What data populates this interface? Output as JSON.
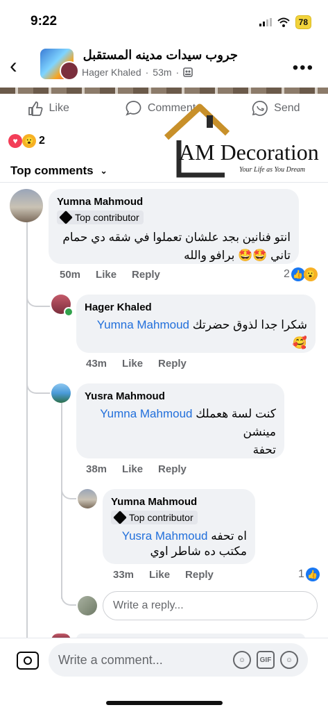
{
  "status": {
    "time": "9:22",
    "battery": "78"
  },
  "header": {
    "group_name": "جروب سيدات مدينه المستقبل",
    "poster": "Hager Khaled",
    "time": "53m"
  },
  "post_actions": {
    "like": "Like",
    "comment": "Comment",
    "send": "Send"
  },
  "watermark": {
    "brand": "AM Decoration",
    "tagline": "Your Life as You Dream"
  },
  "reactions": {
    "count": "2"
  },
  "sort": {
    "label": "Top comments"
  },
  "comments": [
    {
      "author": "Yumna Mahmoud",
      "badge": "Top contributor",
      "text_line1": "انتو فنانين بجد علشان تعملوا في شقه دي حمام",
      "text_line2": "تاني 🤩🤩 برافو والله",
      "time": "50m",
      "like": "Like",
      "reply": "Reply",
      "reaction_count": "2"
    },
    {
      "author": "Hager Khaled",
      "mention": "Yumna Mahmoud",
      "text": "شكرا جدا لذوق حضرتك",
      "emoji": "🥰",
      "time": "43m",
      "like": "Like",
      "reply": "Reply"
    },
    {
      "author": "Yusra Mahmoud",
      "mention": "Yumna Mahmoud",
      "text": "كنت لسة هعملك",
      "text_line2": "مينشن",
      "text_line3": "تحفة",
      "time": "38m",
      "like": "Like",
      "reply": "Reply"
    },
    {
      "author": "Yumna Mahmoud",
      "badge": "Top contributor",
      "mention": "Yusra Mahmoud",
      "text": "اه تحفه",
      "text_line2": "مكتب ده شاطر اوي",
      "time": "33m",
      "like": "Like",
      "reply": "Reply",
      "reaction_count": "1"
    }
  ],
  "reply_box": {
    "placeholder": "Write a reply..."
  },
  "footer": {
    "placeholder": "Write a comment...",
    "gif": "GIF"
  },
  "icons": [
    "back-arrow-icon",
    "group-icon",
    "more-icon",
    "like-icon",
    "comment-icon",
    "send-icon",
    "love-reaction-icon",
    "wow-reaction-icon",
    "chevron-down-icon",
    "top-contributor-icon",
    "like-reaction-icon",
    "camera-icon",
    "avatar-sticker-icon",
    "gif-icon",
    "emoji-icon"
  ],
  "colors": {
    "mention": "#216fdb",
    "like_blue": "#1877f2",
    "love_red": "#f33e58",
    "online_green": "#31a24c",
    "watermark_gold": "#c8902a"
  }
}
